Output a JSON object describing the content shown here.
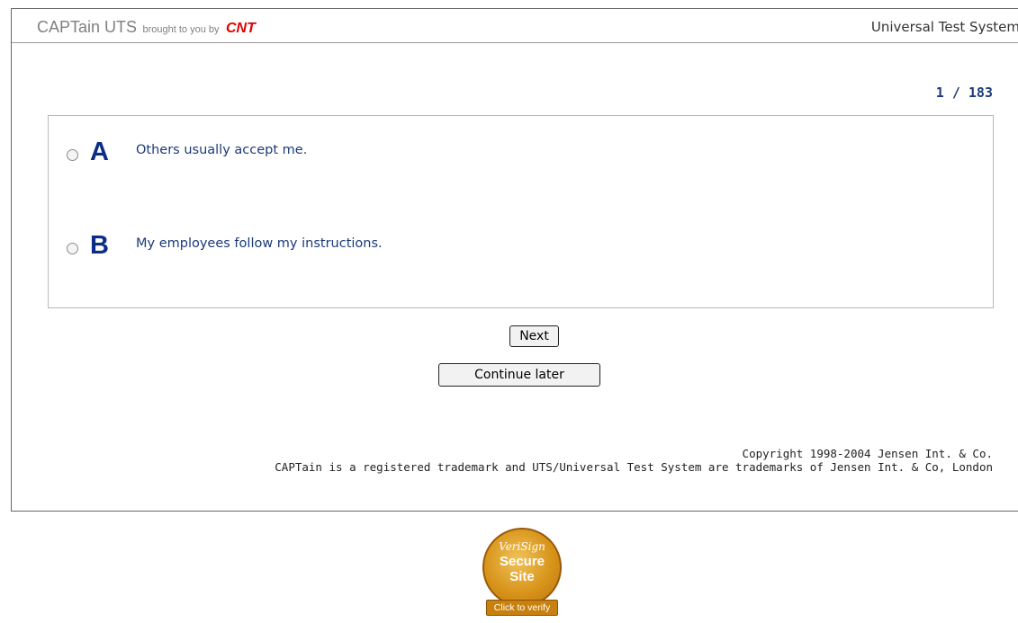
{
  "header": {
    "brand_name": "CAPTain UTS",
    "brand_by": "brought to you by",
    "brand_cnt": "CNT",
    "system_title": "Universal Test System"
  },
  "progress": "1 / 183",
  "question": {
    "options": [
      {
        "letter": "A",
        "text": "Others usually accept me.",
        "selected": false
      },
      {
        "letter": "B",
        "text": "My employees follow my instructions.",
        "selected": false
      }
    ]
  },
  "buttons": {
    "next": "Next",
    "continue_later": "Continue later"
  },
  "footer": {
    "copyright_line1": "Copyright 1998-2004 Jensen Int. & Co.",
    "copyright_line2": "CAPTain is a registered trademark and UTS/Universal Test System are trademarks of Jensen Int. & Co, London"
  },
  "seal": {
    "line1": "VeriSign",
    "line2": "Secure",
    "line3": "Site",
    "ribbon": "Click to verify"
  },
  "colors": {
    "brand_gray": "#808080",
    "cnt_red": "#e00000",
    "option_letter_blue": "#0b2d86",
    "option_text_blue": "#1b3a7a",
    "seal_gold": "#d8941a"
  }
}
